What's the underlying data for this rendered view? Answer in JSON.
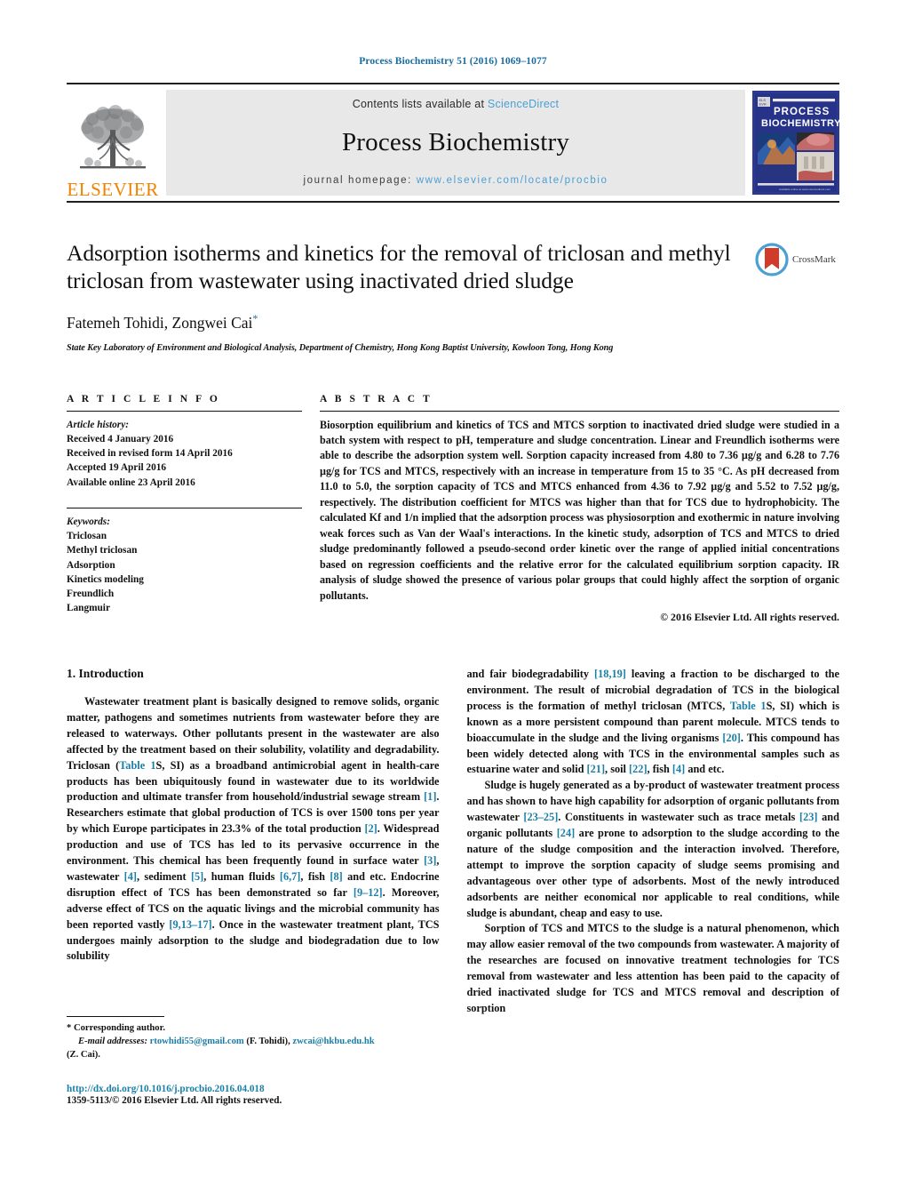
{
  "running_head": "Process Biochemistry 51 (2016) 1069–1077",
  "masthead": {
    "contents_prefix": "Contents lists available at ",
    "contents_link": "ScienceDirect",
    "journal_title": "Process Biochemistry",
    "homepage_prefix": "journal homepage: ",
    "homepage_url": "www.elsevier.com/locate/procbio",
    "publisher_wordmark": "ELSEVIER",
    "cover_line1": "PROCESS",
    "cover_line2": "BIOCHEMISTRY",
    "accent_orange": "#ef8200",
    "link_blue": "#4a9fd4"
  },
  "article": {
    "title": "Adsorption isotherms and kinetics for the removal of triclosan and methyl triclosan from wastewater using inactivated dried sludge",
    "authors": "Fatemeh Tohidi, Zongwei Cai",
    "corresponding_marker": "*",
    "affiliation": "State Key Laboratory of Environment and Biological Analysis, Department of Chemistry, Hong Kong Baptist University, Kowloon Tong, Hong Kong",
    "crossmark_label": "CrossMark"
  },
  "article_info": {
    "heading": "A R T I C L E   I N F O",
    "history_label": "Article history:",
    "history": [
      "Received 4 January 2016",
      "Received in revised form 14 April 2016",
      "Accepted 19 April 2016",
      "Available online 23 April 2016"
    ],
    "keywords_label": "Keywords:",
    "keywords": [
      "Triclosan",
      "Methyl triclosan",
      "Adsorption",
      "Kinetics modeling",
      "Freundlich",
      "Langmuir"
    ]
  },
  "abstract": {
    "heading": "A B S T R A C T",
    "text": "Biosorption equilibrium and kinetics of TCS and MTCS sorption to inactivated dried sludge were studied in a batch system with respect to pH, temperature and sludge concentration. Linear and Freundlich isotherms were able to describe the adsorption system well. Sorption capacity increased from 4.80 to 7.36 µg/g and 6.28 to 7.76 µg/g for TCS and MTCS, respectively with an increase in temperature from 15 to 35 °C. As pH decreased from 11.0 to 5.0, the sorption capacity of TCS and MTCS enhanced from 4.36 to 7.92 µg/g and 5.52 to 7.52 µg/g, respectively. The distribution coefficient for MTCS was higher than that for TCS due to hydrophobicity. The calculated Kf and 1/n implied that the adsorption process was physiosorption and exothermic in nature involving weak forces such as Van der Waal's interactions. In the kinetic study, adsorption of TCS and MTCS to dried sludge predominantly followed a pseudo-second order kinetic over the range of applied initial concentrations based on regression coefficients and the relative error for the calculated equilibrium sorption capacity. IR analysis of sludge showed the presence of various polar groups that could highly affect the sorption of organic pollutants.",
    "copyright": "© 2016 Elsevier Ltd. All rights reserved."
  },
  "body": {
    "section_number_title": "1.  Introduction",
    "left_paragraph_1_part1": "Wastewater treatment plant is basically designed to remove solids, organic matter, pathogens and sometimes nutrients from wastewater before they are released to waterways. Other pollutants present in the wastewater are also affected by the treatment based on their solubility, volatility and degradability. Triclosan (",
    "ref_table1s": "Table 1",
    "left_paragraph_1_part2": "S, SI) as a broadband antimicrobial agent in health-care products has been ubiquitously found in wastewater due to its worldwide production and ultimate transfer from household/industrial sewage stream ",
    "ref_1": "[1]",
    "left_paragraph_1_part3": ". Researchers estimate that global production of TCS is over 1500 tons per year by which Europe participates in 23.3% of the total production ",
    "ref_2": "[2]",
    "left_paragraph_1_part4": ". Widespread production and use of TCS has led to its pervasive occurrence in the environment. This chemical has been frequently found in surface water ",
    "ref_3": "[3]",
    "left_paragraph_1_part5": ", wastewater ",
    "ref_4": "[4]",
    "left_paragraph_1_part6": ", sediment ",
    "ref_5": "[5]",
    "left_paragraph_1_part7": ", human fluids ",
    "ref_67": "[6,7]",
    "left_paragraph_1_part8": ", fish ",
    "ref_8": "[8]",
    "left_paragraph_1_part9": " and etc. Endocrine disruption effect of TCS has been demonstrated so far ",
    "ref_9_12": "[9–12]",
    "left_paragraph_1_part10": ". Moreover, adverse effect of TCS on the aquatic livings and the microbial community has been reported vastly ",
    "ref_9_13_17": "[9,13–17]",
    "left_paragraph_1_part11": ". Once in the wastewater treatment plant, TCS undergoes mainly adsorption to the sludge and biodegradation due to low solubility",
    "right_paragraph_1_part1": "and fair biodegradability ",
    "ref_18_19": "[18,19]",
    "right_paragraph_1_part2": " leaving a fraction to be discharged to the environment. The result of microbial degradation of TCS in the biological process is the formation of methyl triclosan (MTCS, ",
    "ref_table1s_b": "Table 1",
    "right_paragraph_1_part3": "S, SI) which is known as a more persistent compound than parent molecule. MTCS tends to bioaccumulate in the sludge and the living organisms ",
    "ref_20": "[20]",
    "right_paragraph_1_part4": ". This compound has been widely detected along with TCS in the environmental samples such as estuarine water and solid ",
    "ref_21": "[21]",
    "right_paragraph_1_part5": ", soil ",
    "ref_22": "[22]",
    "right_paragraph_1_part6": ", fish ",
    "ref_4b": "[4]",
    "right_paragraph_1_part7": " and etc.",
    "right_paragraph_2_part1": "Sludge is hugely generated as a by-product of wastewater treatment process and has shown to have high capability for adsorption of organic pollutants from wastewater ",
    "ref_23_25": "[23–25]",
    "right_paragraph_2_part2": ". Constituents in wastewater such as trace metals ",
    "ref_23": "[23]",
    "right_paragraph_2_part3": " and organic pollutants ",
    "ref_24": "[24]",
    "right_paragraph_2_part4": " are prone to adsorption to the sludge according to the nature of the sludge composition and the interaction involved. Therefore, attempt to improve the sorption capacity of sludge seems promising and advantageous over other type of adsorbents. Most of the newly introduced adsorbents are neither economical nor applicable to real conditions, while sludge is abundant, cheap and easy to use.",
    "right_paragraph_3": "Sorption of TCS and MTCS to the sludge is a natural phenomenon, which may allow easier removal of the two compounds from wastewater. A majority of the researches are focused on innovative treatment technologies for TCS removal from wastewater and less attention has been paid to the capacity of dried inactivated sludge for TCS and MTCS removal and description of sorption"
  },
  "footnote": {
    "corresponding": "*  Corresponding author.",
    "email_label": "E-mail addresses:",
    "email_1": "rtowhidi55@gmail.com",
    "email_1_owner": " (F. Tohidi), ",
    "email_2": "zwcai@hkbu.edu.hk",
    "email_2_owner": "(Z. Cai)."
  },
  "doi": {
    "url": "http://dx.doi.org/10.1016/j.procbio.2016.04.018",
    "issn_line": "1359-5113/© 2016 Elsevier Ltd. All rights reserved."
  }
}
